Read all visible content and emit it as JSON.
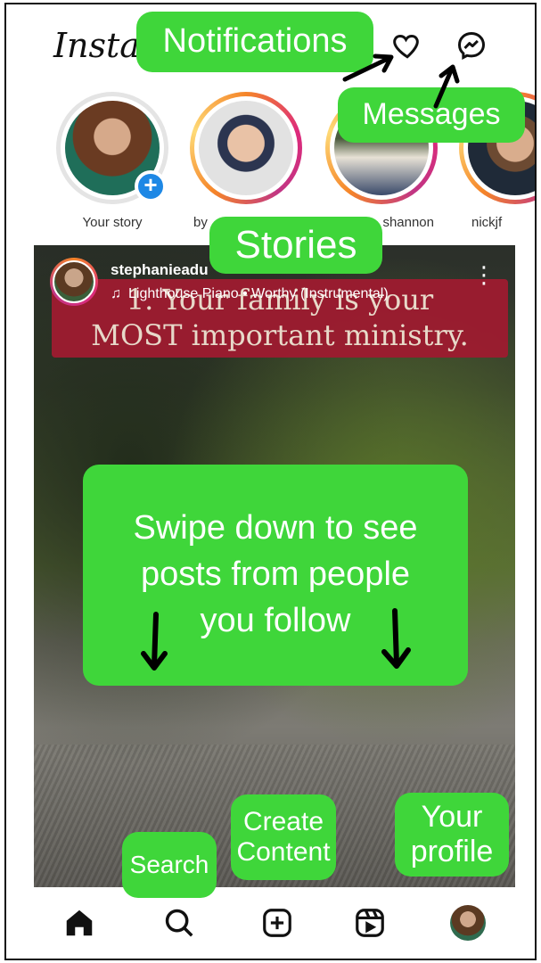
{
  "header": {
    "logo_text": "Instagram",
    "notifications_icon": "heart-icon",
    "messages_icon": "messenger-icon"
  },
  "stories": [
    {
      "label": "Your story"
    },
    {
      "label": "by"
    },
    {
      "label": "shannon"
    },
    {
      "label": "nickjf"
    }
  ],
  "post": {
    "username": "stephanieadu",
    "music": "Lighthouse Piano • Worthy (Instrumental)",
    "overlay_line1": "1. Your family is your",
    "overlay_line2": "MOST important ministry.",
    "more_icon": "more-vertical-icon"
  },
  "nav": {
    "home_icon": "home-icon",
    "search_icon": "search-icon",
    "create_icon": "plus-square-icon",
    "reels_icon": "reels-icon",
    "profile_icon": "profile-avatar"
  },
  "callouts": {
    "notifications": "Notifications",
    "messages": "Messages",
    "stories": "Stories",
    "swipe_line1": "Swipe down to see",
    "swipe_line2": "posts from people",
    "swipe_line3": "you follow",
    "search": "Search",
    "create_line1": "Create",
    "create_line2": "Content",
    "profile_line1": "Your",
    "profile_line2": "profile"
  },
  "colors": {
    "callout_green": "#3fd63a",
    "banner_red": "#9e1b30",
    "story_blue": "#1e88e5"
  }
}
